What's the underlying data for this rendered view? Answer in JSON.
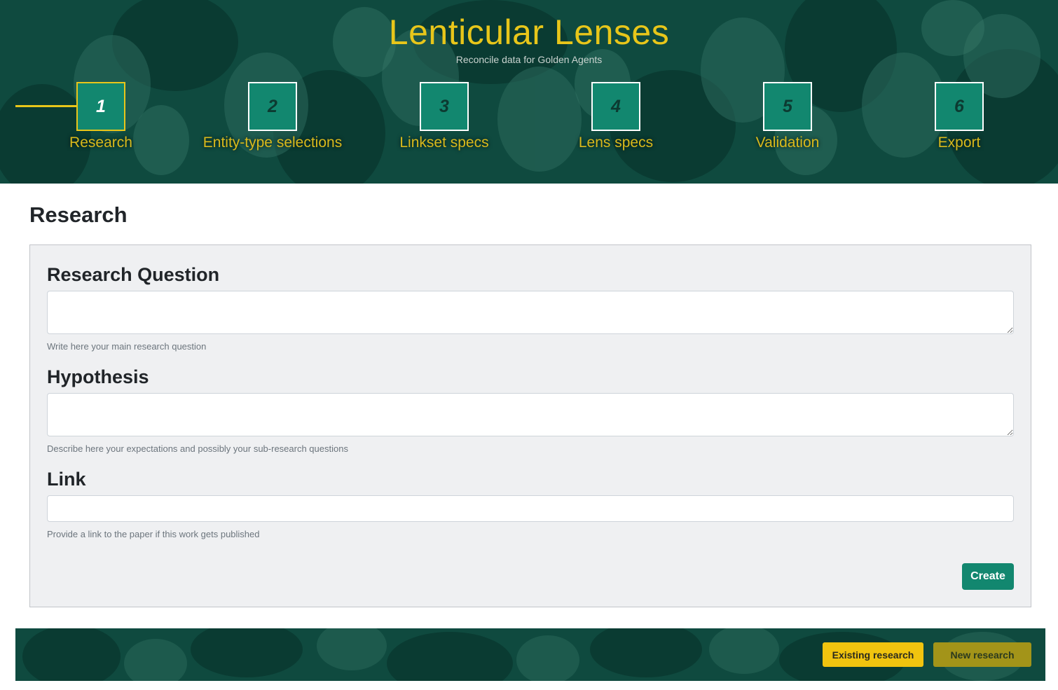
{
  "header": {
    "title": "Lenticular Lenses",
    "subtitle": "Reconcile data for Golden Agents"
  },
  "steps": [
    {
      "number": "1",
      "label": "Research",
      "active": true
    },
    {
      "number": "2",
      "label": "Entity-type selections",
      "active": false
    },
    {
      "number": "3",
      "label": "Linkset specs",
      "active": false
    },
    {
      "number": "4",
      "label": "Lens specs",
      "active": false
    },
    {
      "number": "5",
      "label": "Validation",
      "active": false
    },
    {
      "number": "6",
      "label": "Export",
      "active": false
    }
  ],
  "page": {
    "title": "Research"
  },
  "form": {
    "research_question": {
      "label": "Research Question",
      "value": "",
      "help": "Write here your main research question"
    },
    "hypothesis": {
      "label": "Hypothesis",
      "value": "",
      "help": "Describe here your expectations and possibly your sub-research questions"
    },
    "link": {
      "label": "Link",
      "value": "",
      "help": "Provide a link to the paper if this work gets published"
    },
    "create_label": "Create"
  },
  "footer": {
    "existing_label": "Existing research",
    "new_label": "New research"
  },
  "colors": {
    "accent_gold": "#e8c61a",
    "primary_teal": "#12876f",
    "header_bg": "#0f4a3f"
  }
}
